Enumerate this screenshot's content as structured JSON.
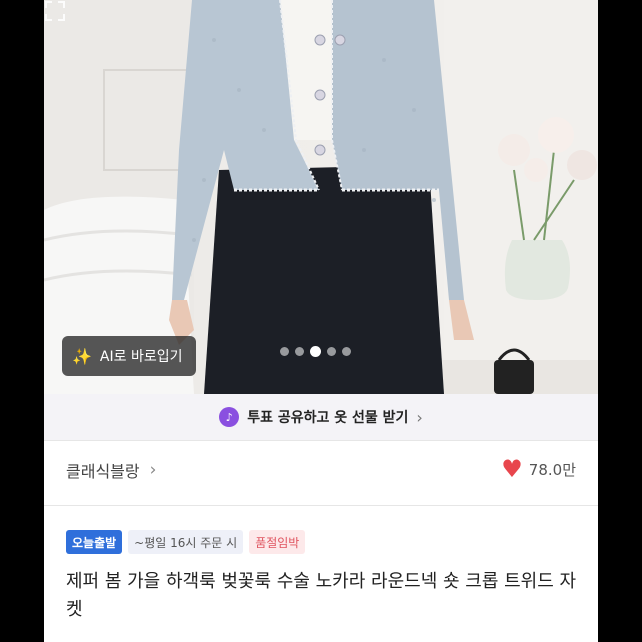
{
  "image_overlay": {
    "ai_button_label": "AI로 바로입기",
    "carousel": {
      "count": 5,
      "active_index": 2
    }
  },
  "vote_banner": {
    "label": "투표 공유하고 옷 선물 받기"
  },
  "shop": {
    "name": "클래식블랑",
    "likes": "78.0만"
  },
  "tags": [
    "오늘출발",
    "~평일 16시 주문 시",
    "품절임박"
  ],
  "product": {
    "title": "제퍼 봄 가을 하객룩 벚꽃룩 수술 노카라 라운드넥 숏 크롭 트위드 자켓"
  },
  "colors": {
    "heart": "#e8464d",
    "today_tag": "#2f6fdb",
    "soldout_text": "#e05560",
    "vote_badge": "#8a4fe0"
  },
  "icons": [
    "sparkle-icon",
    "expand-icon",
    "vote-badge-icon",
    "chevron-right-icon",
    "heart-icon"
  ]
}
